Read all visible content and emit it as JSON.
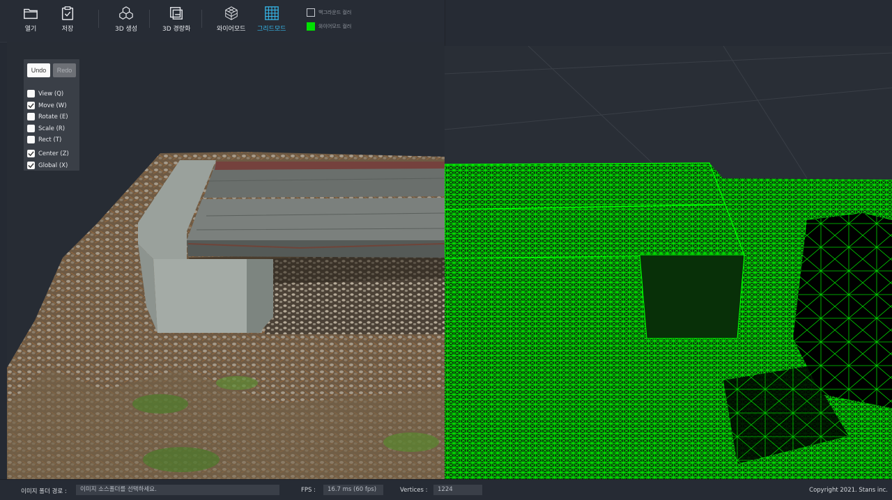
{
  "toolbar": {
    "open": "열기",
    "save": "저장",
    "generate_3d": "3D 생성",
    "lightweight_3d": "3D 경량화",
    "wireframe_mode": "와이어모드",
    "grid_mode": "그리드모드",
    "background_color": "백그라운드 컬러",
    "wireframe_color": "와이어모드 컬러"
  },
  "tools": {
    "undo": "Undo",
    "redo": "Redo",
    "items": [
      {
        "label": "View (Q)",
        "checked": false
      },
      {
        "label": "Move (W)",
        "checked": true
      },
      {
        "label": "Rotate (E)",
        "checked": false
      },
      {
        "label": "Scale (R)",
        "checked": false
      },
      {
        "label": "Rect (T)",
        "checked": false
      },
      {
        "label": "Center (Z)",
        "checked": true
      },
      {
        "label": "Global (X)",
        "checked": true
      }
    ]
  },
  "status": {
    "folder_label": "이미지 폴더 경로 :",
    "folder_placeholder": "이미지 소스폴더를 선택하세요.",
    "fps_label": "FPS :",
    "fps_value": "16.7 ms (60 fps)",
    "vertices_label": "Vertices :",
    "vertices_value": "1224",
    "copyright": "Copyright 2021. Stans inc."
  },
  "colors": {
    "accent": "#35b6e9",
    "wire": "#00e000",
    "background": "#252a33"
  }
}
